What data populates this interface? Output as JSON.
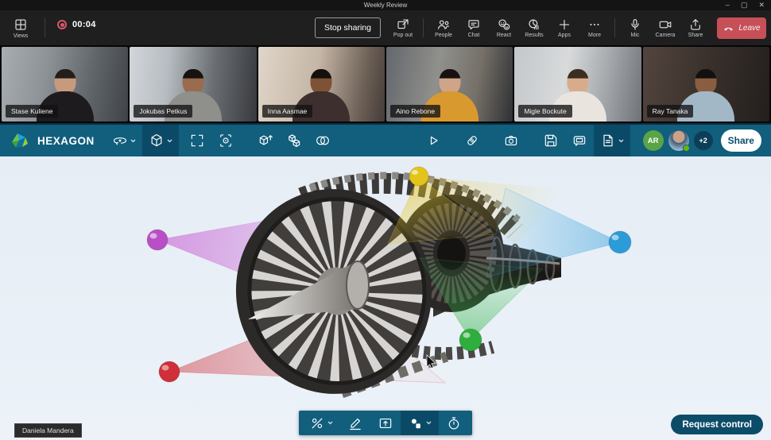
{
  "window": {
    "title": "Weekly Review"
  },
  "meeting_toolbar": {
    "views_label": "Views",
    "recording_time": "00:04",
    "stop_sharing_label": "Stop sharing",
    "actions": [
      {
        "id": "pop-out",
        "label": "Pop out"
      },
      {
        "id": "people",
        "label": "People"
      },
      {
        "id": "chat",
        "label": "Chat"
      },
      {
        "id": "react",
        "label": "React"
      },
      {
        "id": "results",
        "label": "Results"
      },
      {
        "id": "apps",
        "label": "Apps"
      },
      {
        "id": "more",
        "label": "More"
      },
      {
        "id": "mic",
        "label": "Mic"
      },
      {
        "id": "camera",
        "label": "Camera"
      },
      {
        "id": "share",
        "label": "Share"
      }
    ],
    "leave_label": "Leave"
  },
  "participants": [
    {
      "name": "Stase Kuliene"
    },
    {
      "name": "Jokubas Petkus"
    },
    {
      "name": "Inna Aasmae"
    },
    {
      "name": "Aino Rebone"
    },
    {
      "name": "Migle Bockute"
    },
    {
      "name": "Ray Tanaka"
    }
  ],
  "app_toolbar": {
    "brand": "HEXAGON",
    "avatar_initials": "AR",
    "overflow_badge": "+2",
    "share_label": "Share"
  },
  "viewport": {
    "model": "jet-engine",
    "markers": [
      {
        "id": "magenta",
        "color": "#b84fc6"
      },
      {
        "id": "red",
        "color": "#cf2f38"
      },
      {
        "id": "yellow",
        "color": "#e5c419"
      },
      {
        "id": "green",
        "color": "#2fae3e"
      },
      {
        "id": "blue",
        "color": "#2b9cd8"
      }
    ],
    "presenter_tooltip": "Daniela Mandera",
    "request_control_label": "Request control"
  },
  "colors": {
    "app_accent": "#115e7d",
    "app_accent_active": "#0b4a66",
    "leave_red": "#c64f58",
    "viewport_bg": "#e9f0f7"
  }
}
